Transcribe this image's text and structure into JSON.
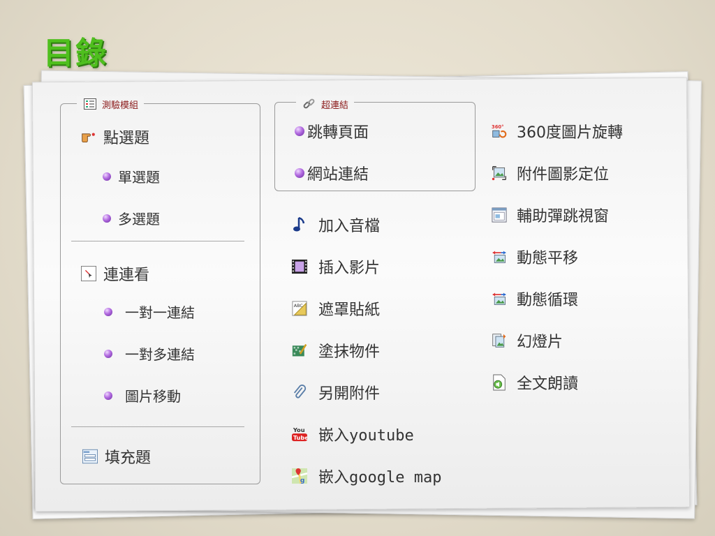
{
  "page": {
    "title": "目錄"
  },
  "group_quiz": {
    "legend": "測驗模組",
    "point_select": "點選題",
    "single_choice": "單選題",
    "multi_choice": "多選題",
    "matching": "連連看",
    "one_to_one": "一對一連結",
    "one_to_many": "一對多連結",
    "image_move": "圖片移動",
    "fill_blank": "填充題"
  },
  "group_hyperlink": {
    "legend": "超連結",
    "jump_page": "跳轉頁面",
    "website_link": "網站連結"
  },
  "middle_items": {
    "add_audio": "加入音檔",
    "insert_video": "插入影片",
    "mask_sticker": "遮罩貼紙",
    "scratch_object": "塗抹物件",
    "attach_file": "另開附件",
    "embed_youtube": "嵌入youtube",
    "embed_google_map": "嵌入google map"
  },
  "right_items": {
    "rotate_360": "360度圖片旋轉",
    "attach_image_position": "附件圖影定位",
    "popup_window": "輔助彈跳視窗",
    "dynamic_pan": "動態平移",
    "dynamic_loop": "動態循環",
    "slideshow": "幻燈片",
    "read_aloud": "全文朗讀"
  },
  "colors": {
    "title_green": "#4fbf1e",
    "legend_red": "#8b1a1a",
    "text": "#333333"
  }
}
